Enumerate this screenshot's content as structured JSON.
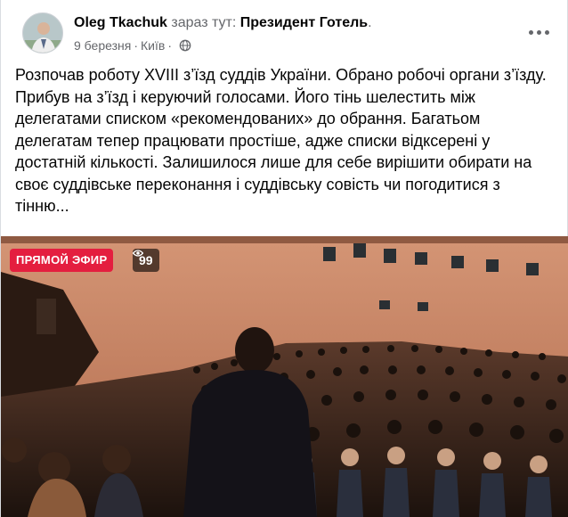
{
  "post": {
    "author": "Oleg Tkachuk",
    "status": "зараз тут:",
    "place": "Президент Готель",
    "period": ".",
    "date": "9 березня",
    "separator": "·",
    "city": "Київ",
    "privacy_icon": "globe-icon",
    "more_icon": "more-options-icon",
    "text": "Розпочав роботу XVIII з’їзд суддів України. Обрано робочі органи з’їзду. Прибув на з’їзд і керуючий голосами. Його тінь шелестить між делегатами списком «рекомендованих» до обрання. Багатьом делегатам тепер працювати простіше, адже списки відксерені у достатній кількості. Залишилося лише для себе вирішити обирати на своє суддівське переконання і суддівську совість чи погодитися з тінню..."
  },
  "video": {
    "live_label": "ПРЯМОЙ ЭФИР",
    "viewer_count": "99",
    "viewer_icon": "eye-icon"
  },
  "colors": {
    "live_red": "#e41e3f",
    "secondary_text": "#65676b",
    "hall_wall": "#c98a6a",
    "hall_dark": "#3a1f14"
  }
}
